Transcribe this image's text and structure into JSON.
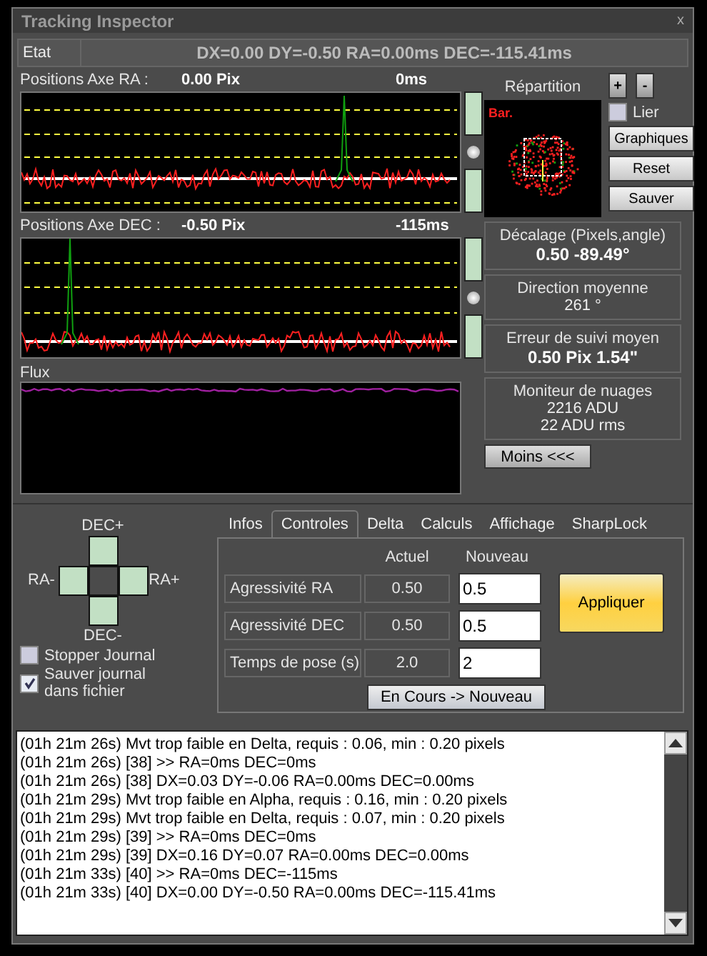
{
  "window": {
    "title": "Tracking Inspector",
    "close": "x"
  },
  "status": {
    "label": "Etat",
    "value": "DX=0.00  DY=-0.50 RA=0.00ms  DEC=-115.41ms"
  },
  "ra_axis": {
    "label": "Positions Axe RA :",
    "pixels": "0.00 Pix",
    "ms": "0ms"
  },
  "dec_axis": {
    "label": "Positions Axe DEC :",
    "pixels": "-0.50 Pix",
    "ms": "-115ms"
  },
  "distribution": {
    "title": "Répartition",
    "overlay": "Bar."
  },
  "zoom_buttons": [
    "+",
    "-"
  ],
  "lier": {
    "label": "Lier",
    "checked": false
  },
  "side_buttons": [
    "Graphiques",
    "Reset",
    "Sauver"
  ],
  "flux": {
    "label": "Flux"
  },
  "info_boxes": [
    {
      "title": "Décalage (Pixels,angle)",
      "lines": [
        "0.50   -89.49°"
      ],
      "kind": "bold"
    },
    {
      "title": "Direction moyenne",
      "lines": [
        "261 °"
      ],
      "kind": "plain"
    },
    {
      "title": "Erreur de suivi moyen",
      "lines": [
        "0.50 Pix  1.54\""
      ],
      "kind": "bold"
    },
    {
      "title": "Moniteur de nuages",
      "lines": [
        "2216 ADU",
        "22 ADU rms"
      ],
      "kind": "plain"
    }
  ],
  "less_button": "Moins <<<",
  "pad": {
    "up": "DEC+",
    "left": "RA-",
    "right": "RA+",
    "down": "DEC-"
  },
  "log_options": [
    {
      "label": "Stopper Journal",
      "checked": false
    },
    {
      "label": "Sauver journal dans fichier",
      "checked": true
    }
  ],
  "tabs": [
    {
      "label": "Infos",
      "selected": false
    },
    {
      "label": "Controles",
      "selected": true
    },
    {
      "label": "Delta",
      "selected": false
    },
    {
      "label": "Calculs",
      "selected": false
    },
    {
      "label": "Affichage",
      "selected": false
    },
    {
      "label": "SharpLock",
      "selected": false
    }
  ],
  "controls": {
    "col_current": "Actuel",
    "col_new": "Nouveau",
    "rows": [
      {
        "label": "Agressivité RA",
        "current": "0.50",
        "new": "0.5"
      },
      {
        "label": "Agressivité DEC",
        "current": "0.50",
        "new": "0.5"
      },
      {
        "label": "Temps de pose (s)",
        "current": "2.0",
        "new": "2"
      }
    ],
    "apply": "Appliquer",
    "copy": "En Cours -> Nouveau"
  },
  "log": [
    "(01h 21m 26s) Mvt trop faible en Delta, requis : 0.06, min : 0.20 pixels",
    "(01h 21m 26s) [38] >> RA=0ms  DEC=0ms",
    "(01h 21m 26s) [38] DX=0.03  DY=-0.06 RA=0.00ms  DEC=0.00ms",
    "(01h 21m 29s) Mvt trop faible en Alpha, requis : 0.16, min : 0.20 pixels",
    "(01h 21m 29s) Mvt trop faible en Delta, requis : 0.07, min : 0.20 pixels",
    "(01h 21m 29s) [39] >> RA=0ms  DEC=0ms",
    "(01h 21m 29s) [39] DX=0.16  DY=0.07 RA=0.00ms  DEC=0.00ms",
    "(01h 21m 33s) [40] >> RA=0ms  DEC=-115ms",
    "(01h 21m 33s) [40] DX=0.00  DY=-0.50 RA=0.00ms  DEC=-115.41ms"
  ]
}
